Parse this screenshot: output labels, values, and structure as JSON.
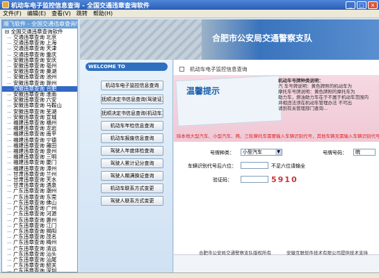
{
  "window": {
    "title": "机动车电子监控信息查询 - 全国交通违章查询软件"
  },
  "menu": {
    "items": [
      "文件(F)",
      "编辑(E)",
      "查看(V)",
      "跳转",
      "帮助(H)"
    ]
  },
  "tree": {
    "header": "顺飞软件 - 全国交通违章查询软件",
    "root": "全国交通违章查询软件",
    "items": [
      "交通违章查询 北京",
      "交通违章查询 上海",
      "交通违章查询 天津",
      "交通违章查询 重庆",
      "安徽违章查询 安庆",
      "安徽违章查询 亳州",
      "安徽违章查询 巢湖",
      "安徽违章查询 池州",
      "安徽违章查询 滁州",
      "安徽违章查询 合肥",
      "安徽违章查询 淮南",
      "安徽违章查询 六安",
      "安徽违章查询 马鞍山",
      "安徽违章查询 芜湖",
      "安徽违章查询 宣城",
      "福建违章查询 福州",
      "福建违章查询 龙岩",
      "福建违章查询 南平",
      "福建违章查询 宁德",
      "福建违章查询 莆田",
      "福建违章查询 泉州",
      "福建违章查询 三明",
      "福建违章查询 厦门",
      "福建违章查询 漳州",
      "甘肃违章查询 兰州",
      "甘肃违章查询 天水",
      "甘肃违章查询 酒泉",
      "广东违章查询 潮州",
      "广东违章查询 东莞",
      "广东违章查询 佛山",
      "广东违章查询 广州",
      "广东违章查询 河源",
      "广东违章查询 惠州",
      "广东违章查询 江门",
      "广东违章查询 揭阳",
      "广东违章查询 茂名",
      "广东违章查询 梅州",
      "广东违章查询 清远",
      "广东违章查询 汕头",
      "广东违章查询 汕尾",
      "广东违章查询 韶关",
      "广东违章查询 深圳"
    ],
    "selected_index": 9
  },
  "banner": {
    "text": "合肥市公安局交通警察支队"
  },
  "sidebar": {
    "welcome": "WELCOME TO",
    "buttons": [
      "机动车电子监控信息查询",
      "抚顺决定书信息查询(驾驶证)",
      "抚顺决定书信息查询(机动车)",
      "机动车年检信息查询",
      "机动车报废信息查询",
      "驾驶人年度体检查询",
      "驾驶人累计记分查询",
      "驾驶人期满换证查询",
      "机动车联系方式变更",
      "驾驶人联系方式变更"
    ]
  },
  "content": {
    "title": "机动车电子监控信息查询",
    "tip_label": "温馨提示",
    "notice_head": "机动车号牌种类说明：",
    "notice_lines": [
      "汽 车号牌说明：黄色牌照的机动车为",
      "摩托车号牌说明：黄色牌照的摩托车为",
      "助力车，燃油助力车在于不属于机动车范围内",
      "并相违法须在机动车管理办法 不可出",
      "请到有关管理部门查询..."
    ],
    "warning": "除本地大型汽车、小型汽车、两、三轮摩托车需要输入车辆识别代号，其他车辆无需输入车辆识别代号",
    "form": {
      "plate_type_label": "号牌种类：",
      "plate_type_value": "小型汽车",
      "plate_number_label": "号牌号码：",
      "plate_number_value": "皖",
      "vin_label": "车辆识别代号后六位：",
      "vin_hint": "不足六位请输全",
      "captcha_label": "验证码：",
      "captcha_value": "5910"
    },
    "footer_left": "合肥市公安局交通警察支队版权所有",
    "footer_right": "安徽互联软件技术有限公司提供技术支持"
  },
  "colors": {
    "title_bar": "#2a5db5",
    "selection": "#316ac5",
    "warning": "#dd2222"
  }
}
